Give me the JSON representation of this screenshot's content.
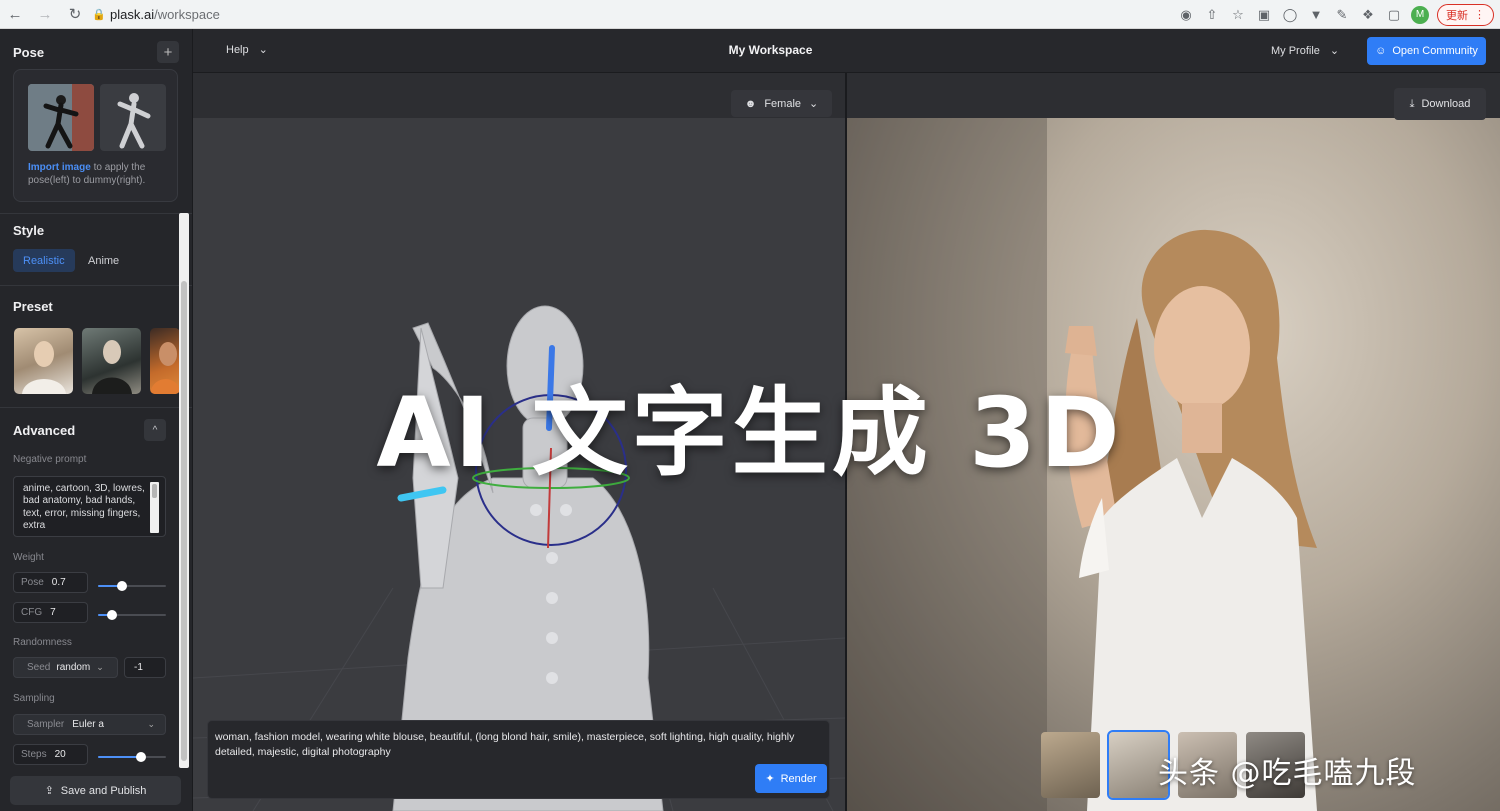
{
  "browser": {
    "url_host": "plask.ai",
    "url_path": "/workspace",
    "avatar_letter": "M",
    "update_label": "更新"
  },
  "sidebar": {
    "pose": {
      "title": "Pose",
      "hint_link": "Import image",
      "hint_text": " to apply the pose(left) to dummy(right)."
    },
    "style": {
      "title": "Style",
      "options": [
        "Realistic",
        "Anime"
      ],
      "selected": "Realistic"
    },
    "preset": {
      "title": "Preset"
    },
    "advanced": {
      "title": "Advanced",
      "negative_prompt_label": "Negative prompt",
      "negative_prompt": "anime, cartoon, 3D, lowres, bad anatomy, bad hands, text, error, missing fingers, extra",
      "weight_label": "Weight",
      "pose_key": "Pose",
      "pose_value": "0.7",
      "pose_level": 0.35,
      "cfg_key": "CFG",
      "cfg_value": "7",
      "cfg_level": 0.2,
      "randomness_label": "Randomness",
      "seed_key": "Seed",
      "seed_mode": "random",
      "seed_value": "-1",
      "sampling_label": "Sampling",
      "sampler_key": "Sampler",
      "sampler_value": "Euler a",
      "steps_key": "Steps",
      "steps_value": "20",
      "steps_level": 0.63
    },
    "save_label": "Save and Publish"
  },
  "topbar": {
    "help_label": "Help",
    "title": "My Workspace",
    "profile_label": "My Profile",
    "community_label": "Open Community"
  },
  "viewport": {
    "gender_label": "Female",
    "download_label": "Download",
    "prompt": "woman, fashion model, wearing white blouse, beautiful, (long blond hair, smile), masterpiece, soft lighting, high quality, highly detailed, majestic, digital photography",
    "render_label": "Render"
  },
  "overlay": {
    "title": "AI 文字生成 3D",
    "watermark": "头条 @吃毛嗑九段"
  },
  "colors": {
    "accent": "#2f7df6",
    "panel": "#25262a",
    "background": "#1e1f22"
  }
}
